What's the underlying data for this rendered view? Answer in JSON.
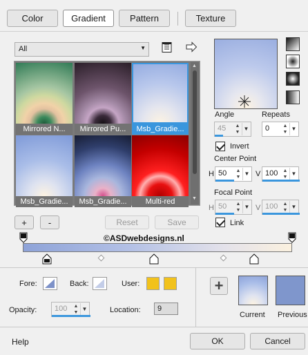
{
  "tabs": [
    {
      "label": "Color"
    },
    {
      "label": "Gradient"
    },
    {
      "label": "Pattern"
    },
    {
      "label": "Texture"
    }
  ],
  "filter": {
    "selected": "All"
  },
  "gradients": [
    {
      "caption": "Mirrored N..."
    },
    {
      "caption": "Mirrored Pu..."
    },
    {
      "caption": "Msb_Gradie..."
    },
    {
      "caption": "Msb_Gradie..."
    },
    {
      "caption": "Msb_Gradie..."
    },
    {
      "caption": "Multi-red"
    }
  ],
  "preview": {
    "angle_label": "Angle",
    "repeats_label": "Repeats",
    "angle_value": "45",
    "repeats_value": "0"
  },
  "invert": {
    "label": "Invert",
    "checked": true
  },
  "center_point": {
    "label": "Center Point",
    "h_label": "H",
    "h_value": "50",
    "v_label": "V",
    "v_value": "100"
  },
  "focal_point": {
    "label": "Focal Point",
    "h_label": "H",
    "h_value": "50",
    "v_label": "V",
    "v_value": "100"
  },
  "link": {
    "label": "Link",
    "checked": true
  },
  "buttons": {
    "add": "+",
    "remove": "-",
    "reset": "Reset",
    "save": "Save"
  },
  "watermark": "©ASDwebdesigns.nl",
  "stops_panel": {
    "fore_label": "Fore:",
    "back_label": "Back:",
    "user_label": "User:",
    "opacity_label": "Opacity:",
    "opacity_value": "100",
    "location_label": "Location:",
    "location_value": "9"
  },
  "swatches": {
    "current_label": "Current",
    "previous_label": "Previous",
    "add_icon": "+"
  },
  "footer": {
    "help": "Help",
    "ok": "OK",
    "cancel": "Cancel"
  },
  "colors": {
    "accent": "#3a96dd",
    "user_yellow": "#f2c21b",
    "gradient_blue": "#9aaee0",
    "gradient_cream": "#fbf1df"
  }
}
